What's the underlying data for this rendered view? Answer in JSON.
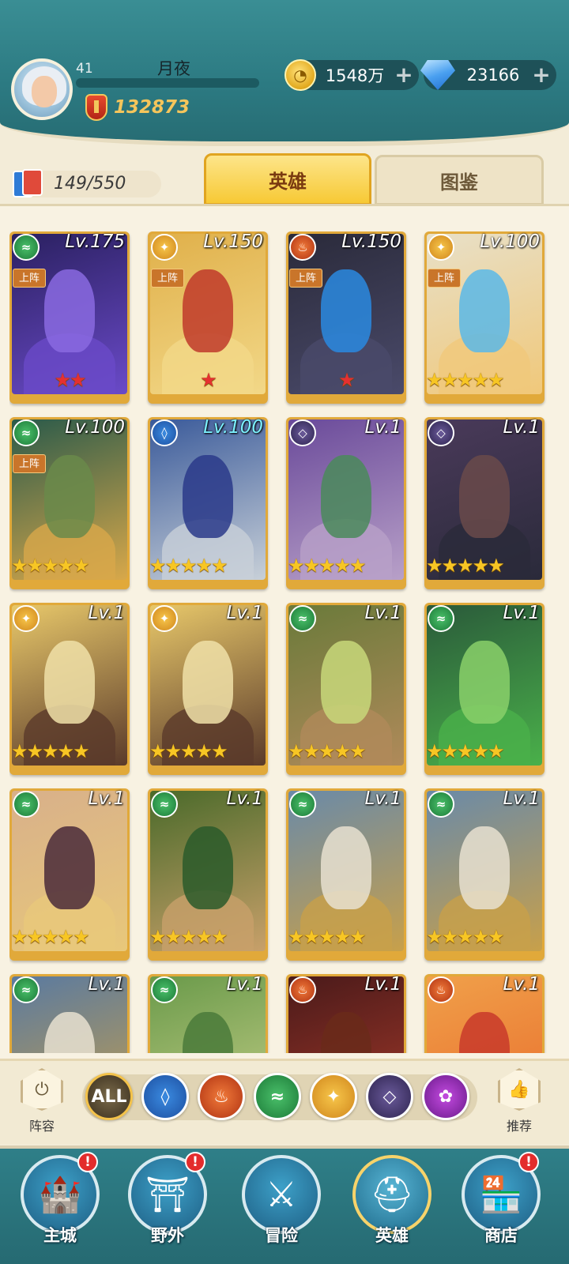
{
  "header": {
    "player_level": "41",
    "player_name": "月夜",
    "power": "132873",
    "gold": "1548万",
    "gems": "23166",
    "plus_icon": "+"
  },
  "cards_count": "149/550",
  "tabs": {
    "heroes": "英雄",
    "codex": "图鉴"
  },
  "heroes": [
    {
      "level": "Lv.175",
      "element": "nature-icon",
      "deployed": "上阵",
      "stars": "★★",
      "star_color": "red"
    },
    {
      "level": "Lv.150",
      "element": "light-icon",
      "deployed": "上阵",
      "stars": "★",
      "star_color": "red"
    },
    {
      "level": "Lv.150",
      "element": "fire-icon",
      "deployed": "上阵",
      "stars": "★",
      "star_color": "red"
    },
    {
      "level": "Lv.100",
      "element": "light-icon",
      "deployed": "上阵",
      "stars": "★★★★★",
      "star_color": "gold"
    },
    {
      "level": "Lv.100",
      "element": "nature-icon",
      "deployed": "上阵",
      "stars": "★★★★★",
      "star_color": "gold"
    },
    {
      "level": "Lv.100",
      "element": "water-icon",
      "deployed": "",
      "stars": "★★★★★",
      "star_color": "gold"
    },
    {
      "level": "Lv.1",
      "element": "dark-icon",
      "deployed": "",
      "stars": "★★★★★",
      "star_color": "gold"
    },
    {
      "level": "Lv.1",
      "element": "dark-icon",
      "deployed": "",
      "stars": "★★★★★",
      "star_color": "gold"
    },
    {
      "level": "Lv.1",
      "element": "light-icon",
      "deployed": "",
      "stars": "★★★★★",
      "star_color": "gold"
    },
    {
      "level": "Lv.1",
      "element": "light-icon",
      "deployed": "",
      "stars": "★★★★★",
      "star_color": "gold"
    },
    {
      "level": "Lv.1",
      "element": "nature-icon",
      "deployed": "",
      "stars": "★★★★★",
      "star_color": "gold"
    },
    {
      "level": "Lv.1",
      "element": "nature-icon",
      "deployed": "",
      "stars": "★★★★★",
      "star_color": "gold"
    },
    {
      "level": "Lv.1",
      "element": "nature-icon",
      "deployed": "",
      "stars": "★★★★★",
      "star_color": "gold"
    },
    {
      "level": "Lv.1",
      "element": "nature-icon",
      "deployed": "",
      "stars": "★★★★★",
      "star_color": "gold"
    },
    {
      "level": "Lv.1",
      "element": "nature-icon",
      "deployed": "",
      "stars": "★★★★★",
      "star_color": "gold"
    },
    {
      "level": "Lv.1",
      "element": "nature-icon",
      "deployed": "",
      "stars": "★★★★★",
      "star_color": "gold"
    },
    {
      "level": "Lv.1",
      "element": "nature-icon",
      "deployed": "",
      "stars": "",
      "star_color": "gold"
    },
    {
      "level": "Lv.1",
      "element": "nature-icon",
      "deployed": "",
      "stars": "",
      "star_color": "gold"
    },
    {
      "level": "Lv.1",
      "element": "fire-icon",
      "deployed": "",
      "stars": "",
      "star_color": "gold"
    },
    {
      "level": "Lv.1",
      "element": "fire-icon",
      "deployed": "",
      "stars": "",
      "star_color": "gold"
    }
  ],
  "filters": {
    "lineup_label": "阵容",
    "all_label": "ALL",
    "recommend_label": "推荐"
  },
  "nav": {
    "main_city": "主城",
    "wild": "野外",
    "adventure": "冒险",
    "heroes": "英雄",
    "shop": "商店",
    "badge": "!"
  }
}
